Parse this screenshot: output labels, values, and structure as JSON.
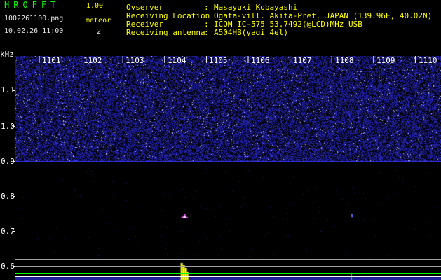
{
  "header": {
    "logo": "HROFFT",
    "version": "1.00",
    "filename": "1002261100.png",
    "datetime": "10.02.26 11:00",
    "meteor_label": "meteor",
    "meteor_count": "2"
  },
  "meta": [
    {
      "label": "Ovserver",
      "value": "Masayuki Kobayashi"
    },
    {
      "label": "Receiving Location",
      "value": "Ogata-vill. Akita-Pref. JAPAN (139.96E, 40.02N)"
    },
    {
      "label": "Receiver",
      "value": "ICOM IC-575 53.7492(@LCD)MHz USB"
    },
    {
      "label": "Receiving antenna",
      "value": "A504HB(yagi 4el)"
    }
  ],
  "chart_data": {
    "type": "heatmap",
    "ylabel": "kHz",
    "y_ticks": [
      "1.1",
      "1.0",
      "0.9",
      "0.8",
      "0.7",
      "0.6"
    ],
    "x_ticks": [
      "1101",
      "1102",
      "1103",
      "1104",
      "1105",
      "1106",
      "1107",
      "1108",
      "1109",
      "1110"
    ],
    "ylim": [
      0.58,
      1.18
    ],
    "noise_band_khz": [
      0.89,
      1.18
    ],
    "carrier_line_khz": 0.89,
    "meteor_echoes": [
      {
        "time": 1104.4,
        "freq_khz": 0.735
      },
      {
        "time": 1108.4,
        "freq_khz": 0.74
      }
    ],
    "colors": {
      "background": "#000000",
      "noise": "#3a3aff",
      "echo": "#ff66ff",
      "level": "#ffff00",
      "reference": "#00ff00"
    }
  },
  "icons": [
    "axis-grid",
    "spectrogram"
  ]
}
